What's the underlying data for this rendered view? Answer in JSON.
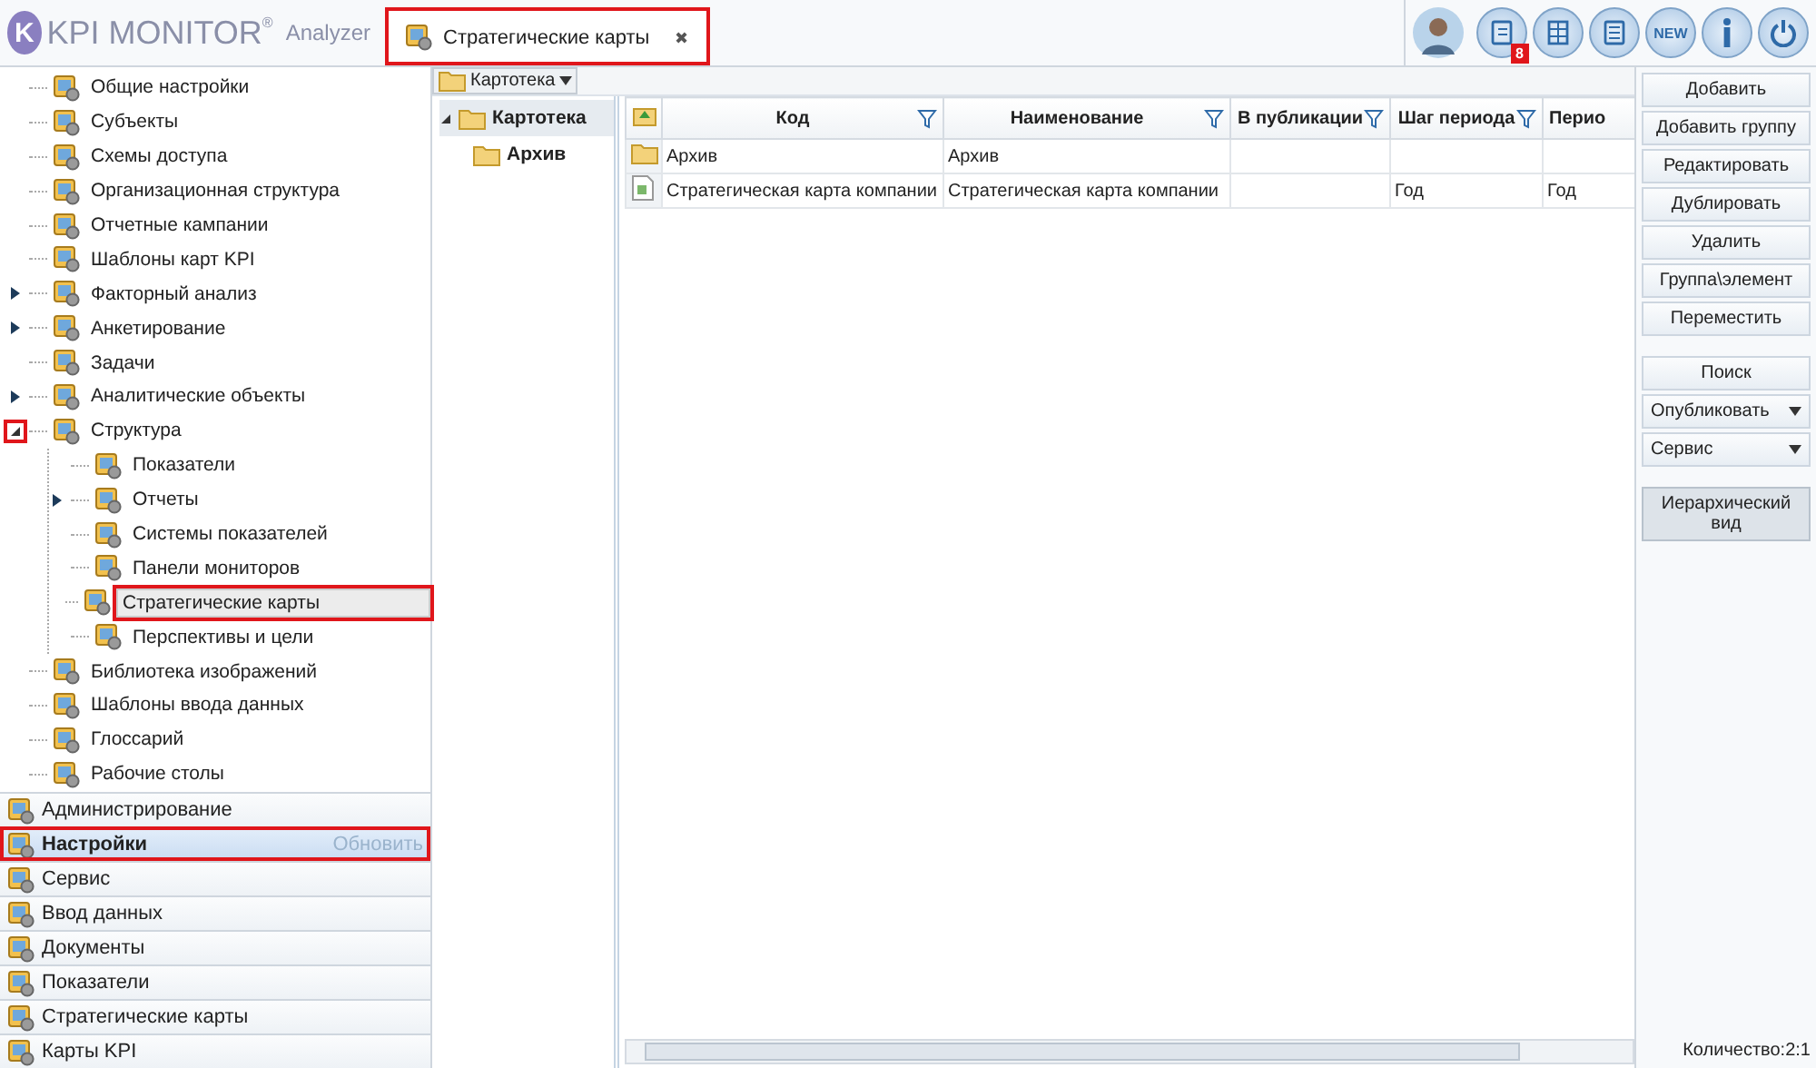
{
  "app": {
    "logo_mark": "K",
    "logo_text": "KPI MONITOR",
    "logo_reg": "®",
    "logo_sub": "Analyzer"
  },
  "tabs": [
    {
      "label": "Стратегические карты",
      "close": "✖",
      "selected": true,
      "highlighted": true
    }
  ],
  "header": {
    "badge": "8",
    "new_label": "NEW"
  },
  "sidebar": {
    "tree": [
      {
        "label": "Общие настройки"
      },
      {
        "label": "Субъекты"
      },
      {
        "label": "Схемы доступа"
      },
      {
        "label": "Организационная структура"
      },
      {
        "label": "Отчетные кампании"
      },
      {
        "label": "Шаблоны карт KPI"
      },
      {
        "label": "Факторный анализ",
        "expanded": false
      },
      {
        "label": "Анкетирование",
        "expanded": false
      },
      {
        "label": "Задачи"
      },
      {
        "label": "Аналитические объекты",
        "expanded": false
      },
      {
        "label": "Структура",
        "expanded": true,
        "expander_highlighted": true,
        "children": [
          {
            "label": "Показатели"
          },
          {
            "label": "Отчеты",
            "expanded": false
          },
          {
            "label": "Системы показателей"
          },
          {
            "label": "Панели мониторов"
          },
          {
            "label": "Стратегические карты",
            "selected": true,
            "highlighted": true
          },
          {
            "label": "Перспективы и цели"
          }
        ]
      },
      {
        "label": "Библиотека изображений"
      },
      {
        "label": "Шаблоны ввода данных"
      },
      {
        "label": "Глоссарий"
      },
      {
        "label": "Рабочие столы"
      }
    ],
    "sections": [
      {
        "label": "Администрирование",
        "selected": false,
        "highlighted": false
      },
      {
        "label": "Настройки",
        "selected": true,
        "highlighted": true,
        "action": "Обновить"
      },
      {
        "label": "Сервис",
        "selected": false,
        "highlighted": false
      },
      {
        "label": "Ввод данных",
        "selected": false,
        "highlighted": false
      },
      {
        "label": "Документы",
        "selected": false,
        "highlighted": false
      },
      {
        "label": "Показатели",
        "selected": false,
        "highlighted": false
      },
      {
        "label": "Стратегические карты",
        "selected": false,
        "highlighted": false
      },
      {
        "label": "Карты KPI",
        "selected": false,
        "highlighted": false
      }
    ]
  },
  "catalog_dropdown": {
    "value": "Картотека"
  },
  "folder_tree": [
    {
      "label": "Картотека",
      "selected": true,
      "expanded": true,
      "children": [
        {
          "label": "Архив",
          "selected": false
        }
      ]
    }
  ],
  "table": {
    "columns": [
      "Код",
      "Наименование",
      "В публикации",
      "Шаг периода",
      "Перио"
    ],
    "rows": [
      {
        "kind": "folder",
        "cells": [
          "Архив",
          "Архив",
          "",
          "",
          ""
        ]
      },
      {
        "kind": "document",
        "cells": [
          "Стратегическая карта компании",
          "Стратегическая карта компании",
          "",
          "Год",
          "Год"
        ]
      }
    ]
  },
  "actions": [
    {
      "label": "Добавить"
    },
    {
      "label": "Добавить группу"
    },
    {
      "label": "Редактировать"
    },
    {
      "label": "Дублировать"
    },
    {
      "label": "Удалить"
    },
    {
      "label": "Группа\\элемент"
    },
    {
      "label": "Переместить"
    }
  ],
  "search_actions": [
    {
      "label": "Поиск",
      "menu": false
    },
    {
      "label": "Опубликовать",
      "menu": true
    },
    {
      "label": "Сервис",
      "menu": true
    }
  ],
  "view_actions": [
    {
      "label": "Иерархический вид",
      "selected": true
    }
  ],
  "status": "Количество:2:1"
}
